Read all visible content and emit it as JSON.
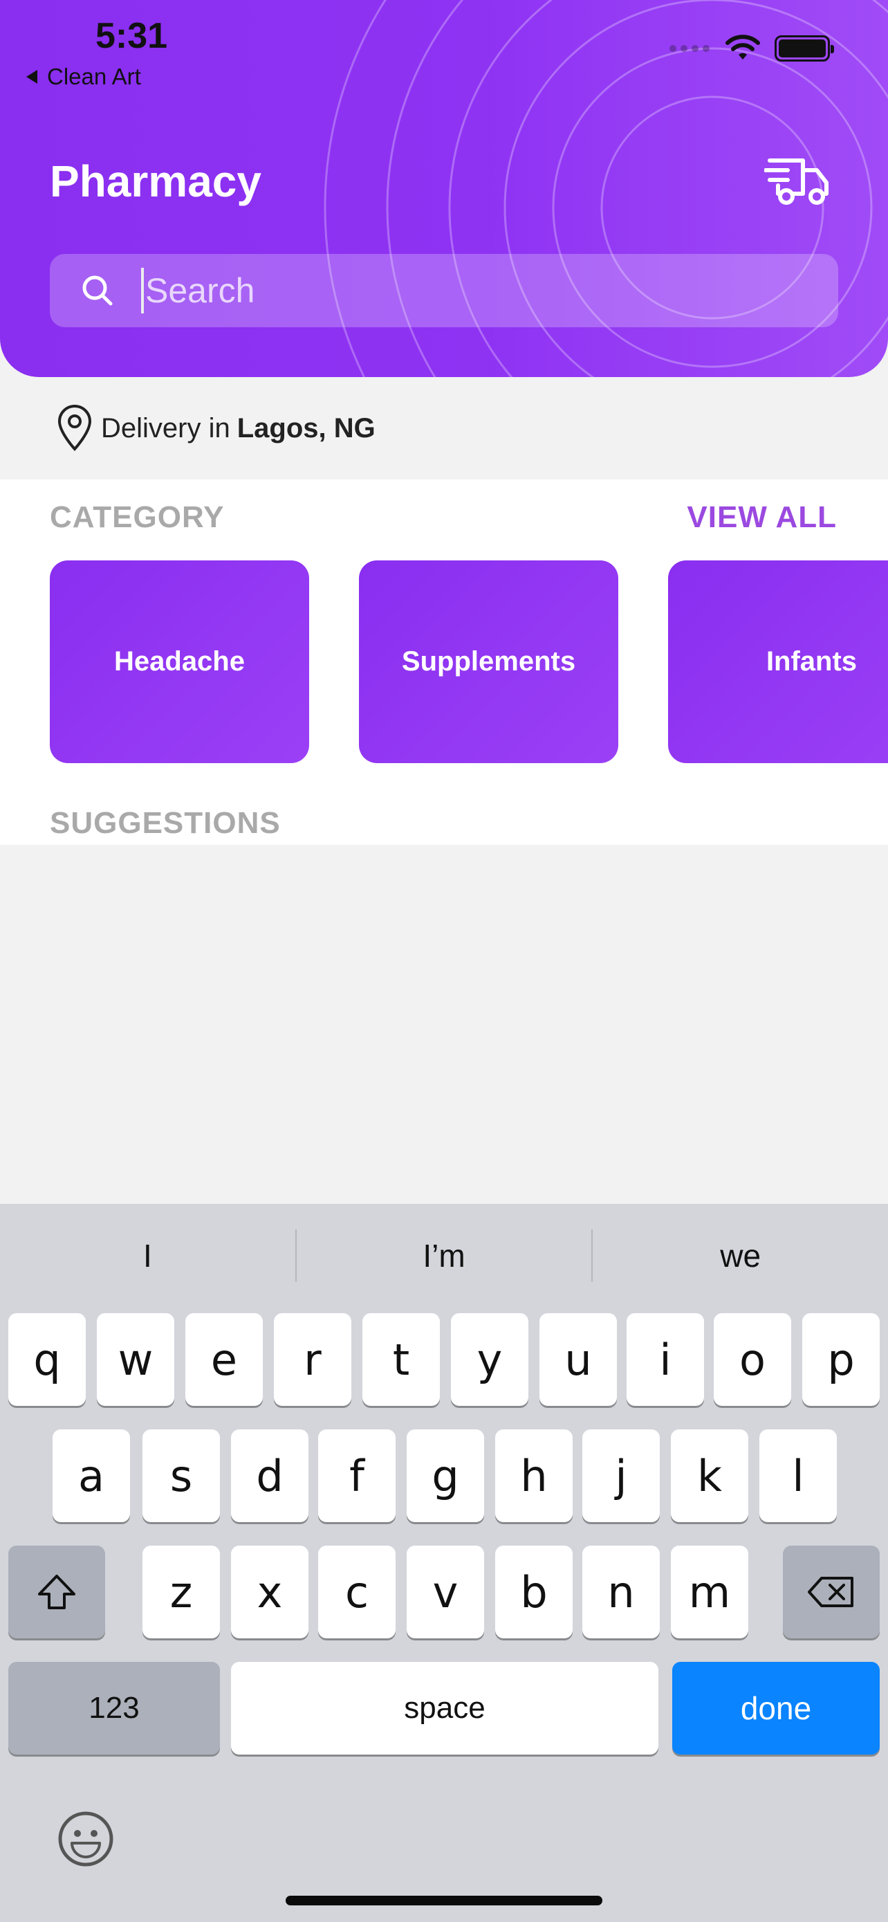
{
  "status_bar": {
    "time": "5:31",
    "back_app": "Clean Art"
  },
  "header": {
    "title": "Pharmacy",
    "cart_icon": "delivery-truck-icon"
  },
  "search": {
    "placeholder": "Search",
    "value": ""
  },
  "delivery": {
    "prefix": "Delivery in",
    "location": "Lagos, NG"
  },
  "category": {
    "heading": "CATEGORY",
    "view_all": "VIEW ALL",
    "items": [
      {
        "label": "Headache"
      },
      {
        "label": "Supplements"
      },
      {
        "label": "Infants"
      }
    ]
  },
  "suggestions_heading": "SUGGESTIONS",
  "keyboard": {
    "predictions": [
      "I",
      "I’m",
      "we"
    ],
    "row1": [
      "q",
      "w",
      "e",
      "r",
      "t",
      "y",
      "u",
      "i",
      "o",
      "p"
    ],
    "row2": [
      "a",
      "s",
      "d",
      "f",
      "g",
      "h",
      "j",
      "k",
      "l"
    ],
    "row3": [
      "z",
      "x",
      "c",
      "v",
      "b",
      "n",
      "m"
    ],
    "numbers_label": "123",
    "space_label": "space",
    "done_label": "done"
  },
  "colors": {
    "brand": "#8a2ef0",
    "accent_text": "#9b49e0",
    "done_key": "#0a84ff"
  }
}
